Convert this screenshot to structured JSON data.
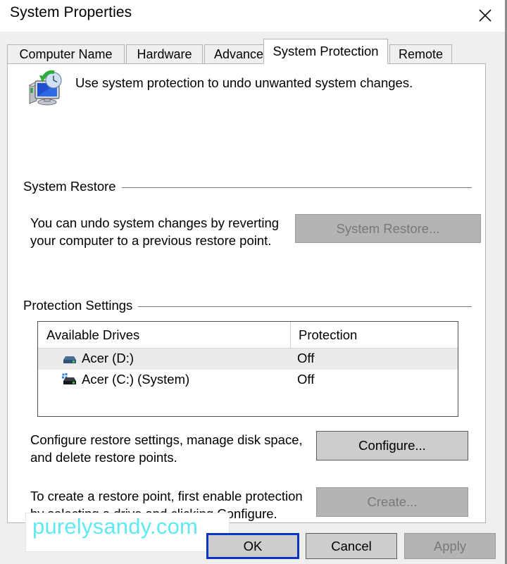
{
  "window": {
    "title": "System Properties",
    "close_icon": "close-icon"
  },
  "tabs": [
    {
      "label": "Computer Name",
      "active": false
    },
    {
      "label": "Hardware",
      "active": false
    },
    {
      "label": "Advanced",
      "active": false
    },
    {
      "label": "System Protection",
      "active": true
    },
    {
      "label": "Remote",
      "active": false
    }
  ],
  "header": {
    "icon": "system-protection-icon",
    "description": "Use system protection to undo unwanted system changes."
  },
  "system_restore": {
    "group_label": "System Restore",
    "description": "You can undo system changes by reverting\nyour computer to a previous restore point.",
    "button_label": "System Restore...",
    "button_enabled": false
  },
  "protection_settings": {
    "group_label": "Protection Settings",
    "columns": [
      "Available Drives",
      "Protection"
    ],
    "rows": [
      {
        "drive": "Acer (D:)",
        "protection": "Off",
        "icon": "hard-drive-icon",
        "selected": true
      },
      {
        "drive": "Acer (C:) (System)",
        "protection": "Off",
        "icon": "system-hard-drive-icon",
        "selected": false
      }
    ],
    "configure": {
      "description": "Configure restore settings, manage disk space,\nand delete restore points.",
      "button_label": "Configure...",
      "button_enabled": true
    },
    "create": {
      "description": "To create a restore point, first enable protection\nby selecting a drive and clicking Configure.",
      "button_label": "Create...",
      "button_enabled": false
    }
  },
  "actions": {
    "ok_label": "OK",
    "cancel_label": "Cancel",
    "apply_label": "Apply",
    "apply_enabled": false,
    "focused_button": "OK"
  },
  "watermark": {
    "text": "purelysandy.com",
    "color": "#5fe9f2"
  },
  "colors": {
    "dialog_background": "#efefef",
    "panel_background": "#ffffff",
    "focus_border": "#0a35c4",
    "selection_row": "#ebebeb",
    "group_rule": "#787878"
  }
}
